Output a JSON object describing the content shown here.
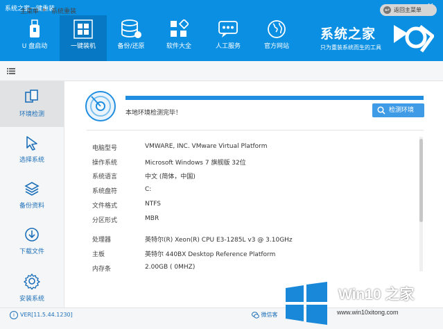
{
  "app_title": "系统之家一键重装",
  "window_controls": {
    "minimize": "－",
    "close": "✕"
  },
  "nav": [
    {
      "label": "U 盘启动",
      "icon": "usb-drive-icon"
    },
    {
      "label": "一键装机",
      "icon": "windows-logo-icon",
      "active": true
    },
    {
      "label": "备份/还原",
      "icon": "database-icon"
    },
    {
      "label": "软件大全",
      "icon": "apps-grid-icon"
    },
    {
      "label": "人工服务",
      "icon": "chat-bubble-icon"
    },
    {
      "label": "官方网站",
      "icon": "globe-icon"
    }
  ],
  "brand": {
    "name": "系统之家",
    "slogan": "只为重装系统而生的工具"
  },
  "breadcrumb": {
    "home": "主菜单",
    "separator": "▶",
    "current": "系统重装"
  },
  "back_button": {
    "label": "返回主菜单",
    "icon": "back-arrow-icon"
  },
  "sidebar": [
    {
      "label": "环境检测",
      "icon": "env-check-icon",
      "active": true
    },
    {
      "label": "选择系统",
      "icon": "cursor-icon"
    },
    {
      "label": "备份资料",
      "icon": "layers-icon"
    },
    {
      "label": "下载文件",
      "icon": "download-icon"
    },
    {
      "label": "安装系统",
      "icon": "gear-icon"
    }
  ],
  "check": {
    "done_text": "本地环境检测完毕！",
    "button_label": "检测环境",
    "progress": 1.0
  },
  "info": [
    {
      "key": "电脑型号",
      "value": "VMWARE, INC. VMware Virtual Platform"
    },
    {
      "key": "操作系统",
      "value": "Microsoft Windows 7 旗舰版  32位"
    },
    {
      "key": "系统语言",
      "value": "中文 (简体，中国)"
    },
    {
      "key": "系统盘符",
      "value": "C:"
    },
    {
      "key": "文件格式",
      "value": "NTFS"
    },
    {
      "key": "分区形式",
      "value": "MBR"
    },
    {
      "key": "处理器",
      "value": "英特尔(R) Xeon(R) CPU E3-1285L v3 @ 3.10GHz"
    },
    {
      "key": "主板",
      "value": "英特尔 440BX Desktop Reference Platform"
    },
    {
      "key": "内存条",
      "value": "2.00GB ( 0MHZ)"
    }
  ],
  "status": {
    "version": "VER[11.5.44.1230]",
    "wechat": "微信客"
  },
  "watermark": {
    "title": "Win10 之家",
    "url": "www.win10xitong.com"
  },
  "colors": {
    "header_blue": "#0a8fe3",
    "active_nav": "#0779c4",
    "accent": "#1f8ee0"
  }
}
